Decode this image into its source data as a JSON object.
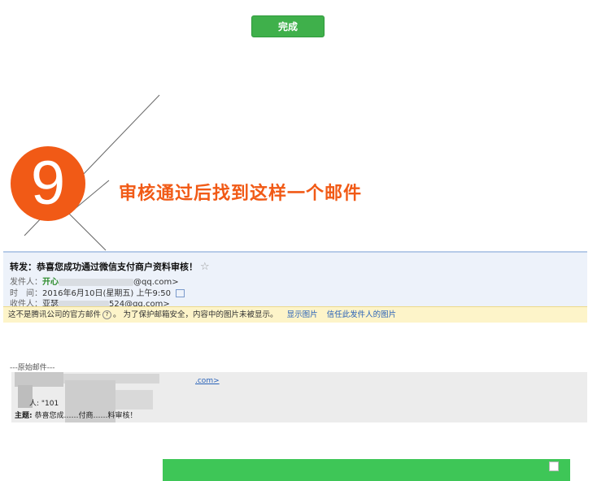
{
  "toolbar": {
    "done_label": "完成"
  },
  "step": {
    "number": "9",
    "caption": "审核通过后找到这样一个邮件"
  },
  "email": {
    "subject": "转发：恭喜您成功通过微信支付商户资料审核！",
    "star": "☆",
    "from_label": "发件人：",
    "from_name": "开心",
    "from_email_tail": "@qq.com>",
    "time_label": "时　间：",
    "time_value": "2016年6月10日(星期五) 上午9:50",
    "to_label": "收件人：",
    "to_name": "亚瑟",
    "to_email_tail": "524@qq.com>",
    "warning": {
      "text_a": "这不是腾讯公司的官方邮件",
      "help_icon": "?",
      "text_b": "。 为了保护邮箱安全，内容中的图片未被显示。",
      "show_images": "显示图片",
      "trust_sender": "信任此发件人的图片"
    }
  },
  "original": {
    "divider": "---原始邮件---",
    "line1_tail": ".com>",
    "line2": "人: \"101",
    "subject_label": "主题:",
    "subject_value": "恭喜您成……付商……料审核！"
  },
  "colors": {
    "accent_green": "#3fb04b",
    "step_orange": "#f15a16",
    "link_blue": "#2962b8",
    "footer_green": "#3ec657"
  }
}
